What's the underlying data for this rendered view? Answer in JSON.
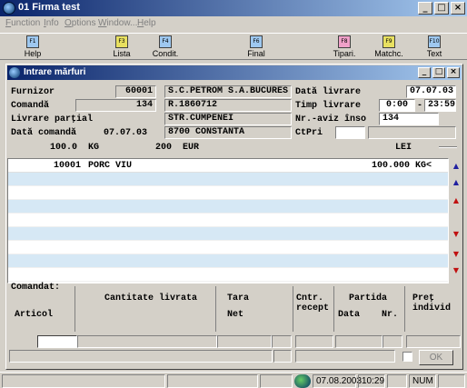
{
  "window": {
    "title": "01  Firma test",
    "buttons": [
      "_",
      "□",
      "×"
    ]
  },
  "menu": [
    "Function",
    "Info",
    "Options",
    "Window...",
    "Help"
  ],
  "toolbar": [
    {
      "label": "Help",
      "key": "F1",
      "icon": "help-icon"
    },
    {
      "label": "Lista",
      "key": "F3",
      "icon": "list-icon"
    },
    {
      "label": "Condit.",
      "key": "F4",
      "icon": "conditions-icon"
    },
    {
      "label": "Final",
      "key": "F6",
      "icon": "final-icon"
    },
    {
      "label": "Tipari.",
      "key": "F8",
      "icon": "print-icon"
    },
    {
      "label": "Matchc.",
      "key": "F9",
      "icon": "matchcode-icon"
    },
    {
      "label": "Text",
      "key": "F10",
      "icon": "text-icon"
    }
  ],
  "child": {
    "title": "Intrare mărfuri",
    "buttons": [
      "_",
      "□",
      "×"
    ]
  },
  "form": {
    "furnizor_label": "Furnizor",
    "furnizor_value": "60001",
    "comanda_label": "Comandă",
    "comanda_value": "134",
    "livrare_label": "Livrare parţial",
    "data_comanda_label": "Dată comandă",
    "data_comanda_value": "07.07.03",
    "supplier_name": "S.C.PETROM S.A.BUCURES",
    "supplier_reg": "R.1860712",
    "supplier_street": "STR.CUMPENEI",
    "supplier_city": "8700 CONSTANTA",
    "data_livrare_label": "Dată livrare",
    "data_livrare_value": "07.07.03",
    "timp_livrare_label": "Timp livrare",
    "timp_from": "0:00",
    "timp_dash": "-",
    "timp_to": "23:59",
    "aviz_label": "Nr.-aviz înso",
    "aviz_value": "134",
    "ctpri_label": "CtPri"
  },
  "totals": {
    "weight": "100.0",
    "weight_unit": "KG",
    "amount": "200",
    "currency": "EUR",
    "lei": "LEI"
  },
  "grid": {
    "rows": [
      {
        "code": "10001",
        "name": "PORC VIU",
        "qty": "100.000",
        "unit": "KG<"
      }
    ]
  },
  "headers": {
    "comandat": "Comandat:",
    "articol": "Articol",
    "cantitate": "Cantitate livrata",
    "tara": "Tara",
    "net": "Net",
    "cntr": "Cntr.",
    "recept": "recept",
    "partida": "Partida",
    "data": "Data",
    "nr": "Nr.",
    "pret": "Preţ",
    "individ": "individ"
  },
  "ok_label": "OK",
  "status": {
    "date": "07.08.2003",
    "time": "10:29",
    "mode": "NUM"
  }
}
